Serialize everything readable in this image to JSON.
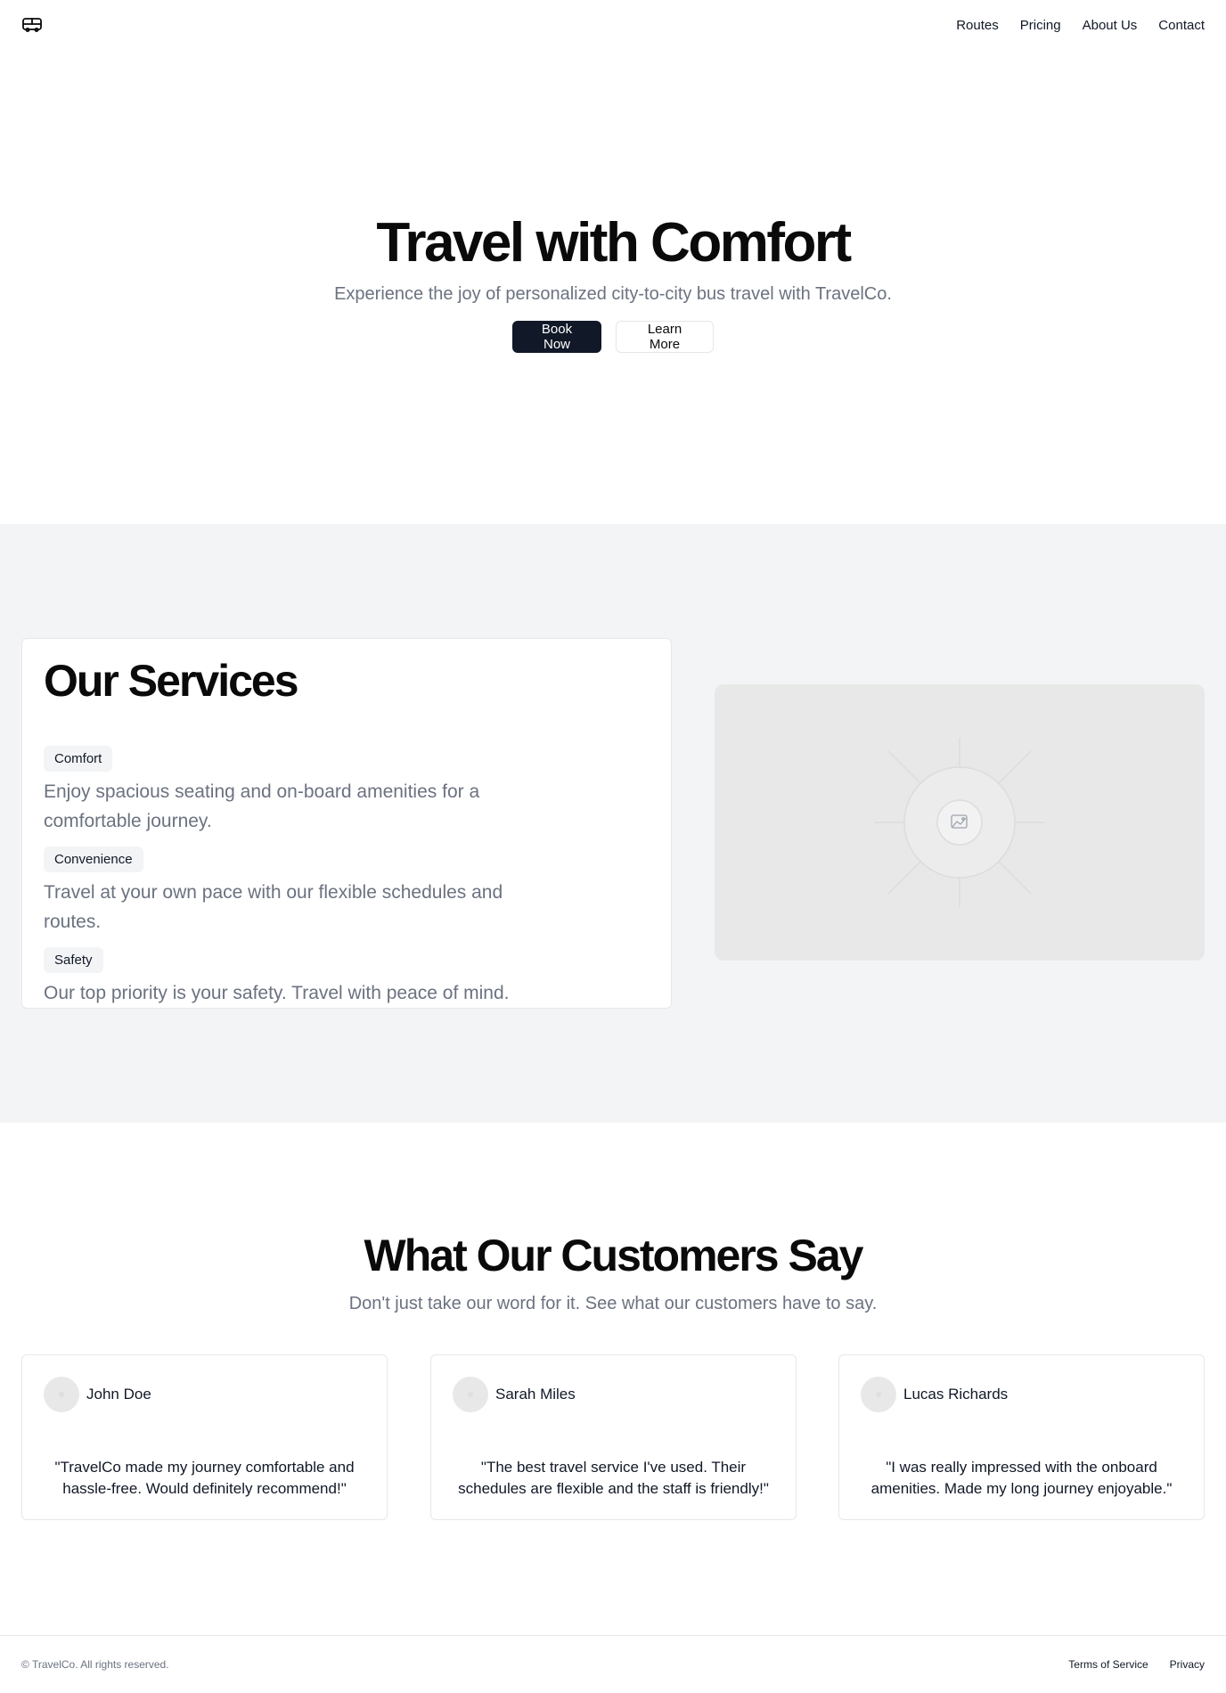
{
  "header": {
    "logo_icon": "bus-icon",
    "nav": [
      "Routes",
      "Pricing",
      "About Us",
      "Contact"
    ]
  },
  "hero": {
    "title": "Travel with Comfort",
    "subtitle": "Experience the joy of personalized city-to-city bus travel with TravelCo.",
    "primary_button": "Book Now",
    "secondary_button": "Learn More"
  },
  "services": {
    "title": "Our Services",
    "items": [
      {
        "label": "Comfort",
        "description": "Enjoy spacious seating and on-board amenities for a comfortable journey."
      },
      {
        "label": "Convenience",
        "description": "Travel at your own pace with our flexible schedules and routes."
      },
      {
        "label": "Safety",
        "description": "Our top priority is your safety. Travel with peace of mind."
      }
    ],
    "image_icon": "image-placeholder-icon"
  },
  "testimonials": {
    "title": "What Our Customers Say",
    "subtitle": "Don't just take our word for it. See what our customers have to say.",
    "items": [
      {
        "name": "John Doe",
        "quote": "\"TravelCo made my journey comfortable and hassle-free. Would definitely recommend!\""
      },
      {
        "name": "Sarah Miles",
        "quote": "\"The best travel service I've used. Their schedules are flexible and the staff is friendly!\""
      },
      {
        "name": "Lucas Richards",
        "quote": "\"I was really impressed with the onboard amenities. Made my long journey enjoyable.\""
      }
    ]
  },
  "footer": {
    "copyright": "© TravelCo. All rights reserved.",
    "links": [
      "Terms of Service",
      "Privacy"
    ]
  },
  "colors": {
    "primary": "#111827",
    "muted_text": "#6b7280",
    "section_bg": "#f3f4f6",
    "border": "#e5e7eb"
  }
}
